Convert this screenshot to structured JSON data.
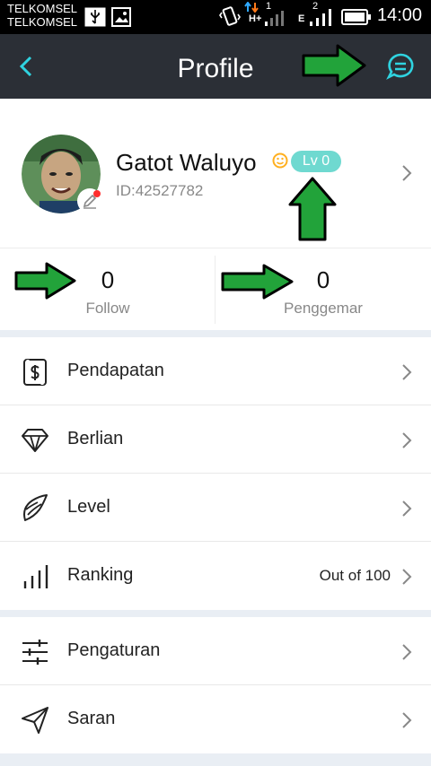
{
  "status_bar": {
    "carrier_1": "TELKOMSEL",
    "carrier_2": "TELKOMSEL",
    "net_1": "H+",
    "sim_1": "1",
    "net_2": "E",
    "sim_2": "2",
    "time": "14:00"
  },
  "header": {
    "title": "Profile",
    "back_icon": "chevron-left-icon",
    "message_icon": "message-bubble-icon",
    "accent_color": "#2fd3e0"
  },
  "profile": {
    "name": "Gatot Waluyo",
    "id_text": "ID:42527782",
    "level_badge": "Lv 0",
    "level_color": "#6fd9d0"
  },
  "stats": {
    "follow_count": "0",
    "follow_label": "Follow",
    "fans_count": "0",
    "fans_label": "Penggemar"
  },
  "menu_group_1": [
    {
      "label": "Pendapatan",
      "icon": "money-document-icon",
      "value": ""
    },
    {
      "label": "Berlian",
      "icon": "diamond-icon",
      "value": ""
    },
    {
      "label": "Level",
      "icon": "wing-icon",
      "value": ""
    },
    {
      "label": "Ranking",
      "icon": "bar-chart-icon",
      "value": "Out of 100"
    }
  ],
  "menu_group_2": [
    {
      "label": "Pengaturan",
      "icon": "sliders-icon",
      "value": ""
    },
    {
      "label": "Saran",
      "icon": "paper-plane-icon",
      "value": ""
    }
  ],
  "annotation_arrow_color": "#22a33a"
}
